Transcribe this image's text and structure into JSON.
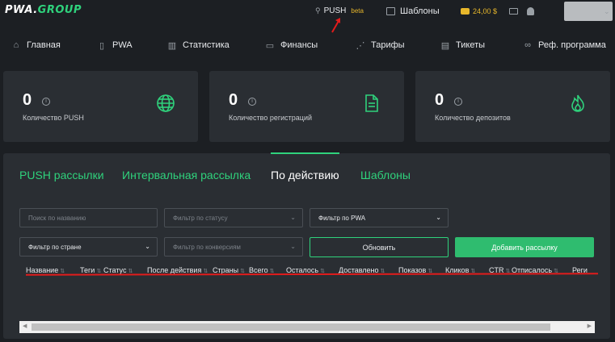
{
  "app": {
    "logo_left": "PWA.",
    "logo_right": "GROUP"
  },
  "topbar": {
    "push_label": "PUSH",
    "push_badge": "beta",
    "templates_label": "Шаблоны",
    "balance": "24,00 $"
  },
  "nav": {
    "items": [
      {
        "label": "Главная",
        "icon": "store-icon"
      },
      {
        "label": "PWA",
        "icon": "phone-icon"
      },
      {
        "label": "Статистика",
        "icon": "bar-chart-icon"
      },
      {
        "label": "Финансы",
        "icon": "wallet-icon"
      },
      {
        "label": "Тарифы",
        "icon": "share-icon"
      },
      {
        "label": "Тикеты",
        "icon": "ticket-icon"
      },
      {
        "label": "Реф. программа",
        "icon": "link-icon"
      }
    ]
  },
  "stats": [
    {
      "value": "0",
      "label": "Количество PUSH",
      "icon": "globe-icon"
    },
    {
      "value": "0",
      "label": "Количество регистраций",
      "icon": "document-icon"
    },
    {
      "value": "0",
      "label": "Количество депозитов",
      "icon": "fire-icon"
    }
  ],
  "tabs": [
    {
      "label": "PUSH рассылки",
      "active": false
    },
    {
      "label": "Интервальная рассылка",
      "active": false
    },
    {
      "label": "По действию",
      "active": true
    },
    {
      "label": "Шаблоны",
      "active": false
    }
  ],
  "filters": {
    "search_placeholder": "Поиск по названию",
    "status_placeholder": "Фильтр по статусу",
    "pwa_filter": "Фильтр по PWA",
    "country_filter": "Фильтр по стране",
    "conversion_placeholder": "Фильтр по конверсиям",
    "refresh_label": "Обновить",
    "add_label": "Добавить рассылку"
  },
  "table": {
    "columns": [
      "Название",
      "Теги",
      "Статус",
      "После действия",
      "Страны",
      "Всего",
      "Осталось",
      "Доставлено",
      "Показов",
      "Кликов",
      "CTR",
      "Отписалось",
      "Реги"
    ]
  },
  "colors": {
    "accent": "#2fd27c",
    "badge": "#e7b72b",
    "annotation": "#e21c1c",
    "background": "#1c1f23",
    "card": "#2a2e33"
  }
}
